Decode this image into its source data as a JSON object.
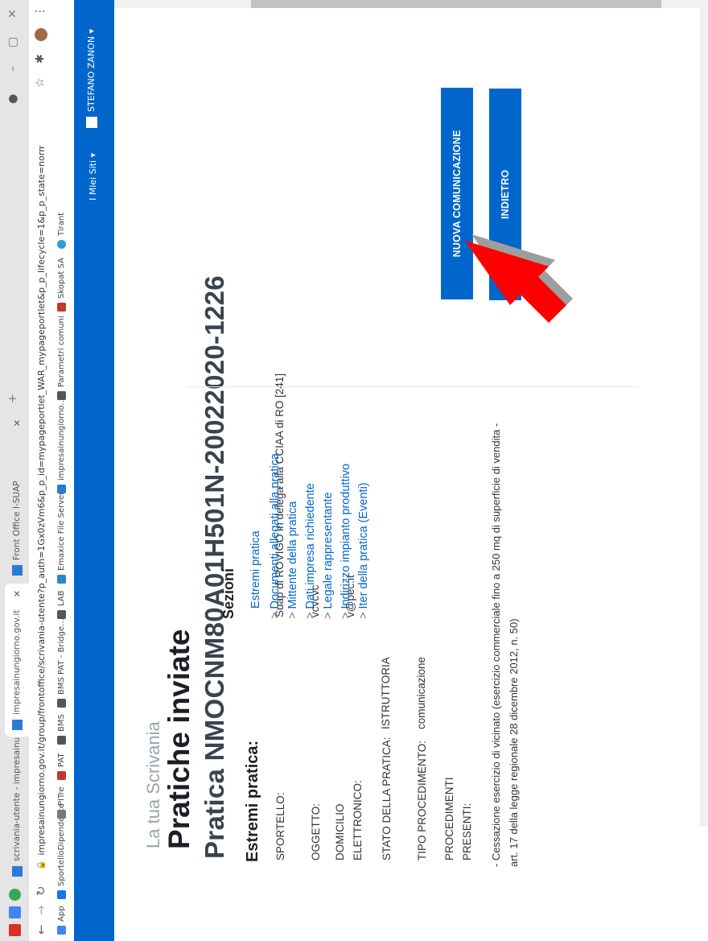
{
  "browser": {
    "tabs": [
      {
        "label": "scrivania-utente - impresainungi",
        "active": false
      },
      {
        "label": "impresainungiorno.gov.it",
        "active": true
      },
      {
        "label": "Front Office I-SUAP",
        "active": false
      }
    ],
    "new_tab": "+",
    "url": "impresainungiorno.gov.it/group/frontoffice/scrivania-utente?p_auth=1Gx0zVm6&p_p_id=mypageportlet_WAR_mypageportlet&p_p_lifecycle=1&p_p_state=normal&p_p_mode=view...",
    "bookmarks": [
      "App",
      "SportelloDipendente",
      "PITre",
      "PAT",
      "BMS",
      "BMS PAT - Bridge...",
      "LAB",
      "Emaxice File Server",
      "impresainungiorno....",
      "Parametri comuni",
      "Skopat SA",
      "Tirant"
    ]
  },
  "appbar": {
    "mieisiti": "I Miei Siti ▾",
    "user": "STEFANO ZANON ▾"
  },
  "page": {
    "subtitle": "La tua Scrivania",
    "title": "Pratiche inviate",
    "pratica": "Pratica NMOCNM80A01H501N-20022020-1226",
    "estremi_heading": "Estremi pratica:",
    "fields": [
      {
        "label": "SPORTELLO:",
        "value": "Suap di ROVIGO in delega alla CCIAA di RO [241]"
      },
      {
        "label": "OGGETTO:",
        "value": "vcvcvc"
      },
      {
        "label": "DOMICILIO\nELETTRONICO:",
        "value": "v@pec.it"
      },
      {
        "label": "STATO DELLA PRATICA:",
        "value": "ISTRUTTORIA"
      },
      {
        "label": "TIPO PROCEDIMENTO:",
        "value": "comunicazione"
      },
      {
        "label": "PROCEDIMENTI\nPRESENTI:",
        "value": ""
      }
    ],
    "procedimento": "- Cessazione esercizio di vicinato (esercizio commerciale fino a 250 mq di superficie di vendita - art. 17 della legge regionale 28 dicembre 2012, n. 50)"
  },
  "sezioni": {
    "heading": "Sezioni",
    "first": "Estremi pratica",
    "links": [
      "Documenti allegati alla pratica",
      "Mittente della pratica",
      "Dati impresa richiedente",
      "Legale rappresentante",
      "Indirizzo impianto produttivo",
      "Iter della pratica (Eventi)"
    ],
    "arrow": ">"
  },
  "buttons": {
    "nuova": "NUOVA COMUNICAZIONE",
    "indietro": "INDIETRO"
  },
  "colors": {
    "brand": "#0066cc",
    "pointer": "#ff0000"
  }
}
